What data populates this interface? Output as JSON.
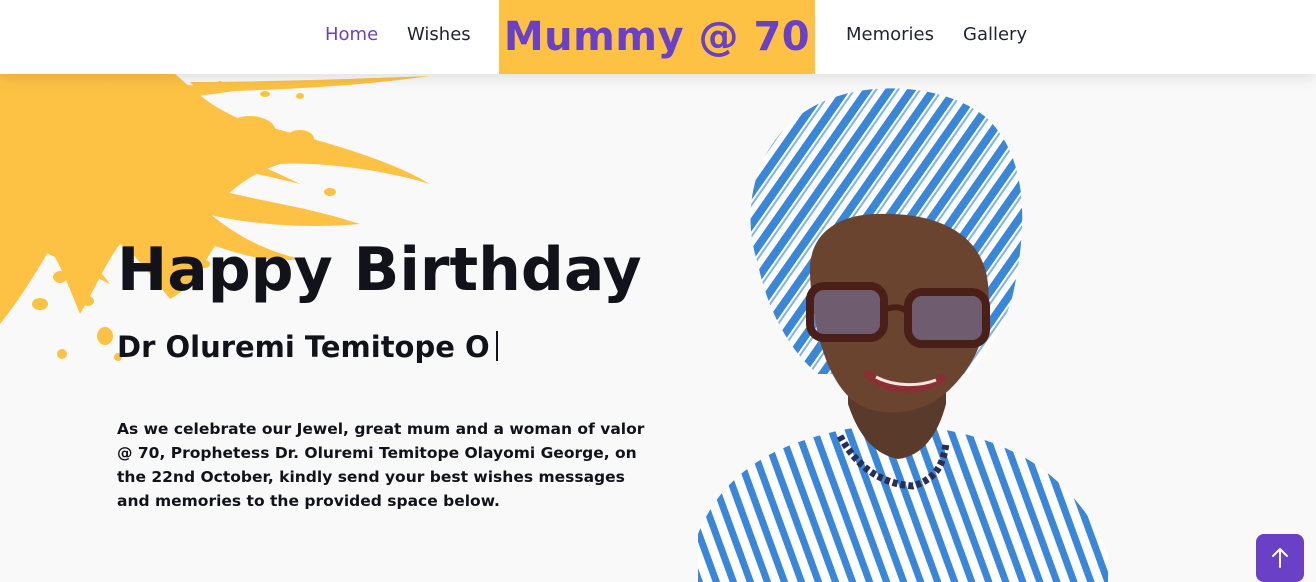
{
  "nav": {
    "home_label": "Home",
    "wishes_label": "Wishes",
    "brand": "Mummy @ 70",
    "memories_label": "Memories",
    "gallery_label": "Gallery",
    "active": "Home"
  },
  "hero": {
    "title": "Happy Birthday",
    "subtitle": "Dr Oluremi Temitope O",
    "message": "As we celebrate our Jewel, great mum and a woman of valor @ 70, Prophetess Dr. Oluremi Temitope Olayomi George, on the 22nd October, kindly send your best wishes messages and memories to the provided space below."
  },
  "colors": {
    "accent": "#6a40c6",
    "brand_bg": "#fdc244",
    "splash": "#fdc244",
    "text": "#12131a"
  },
  "icons": {
    "scroll_top": "arrow-up-icon"
  }
}
